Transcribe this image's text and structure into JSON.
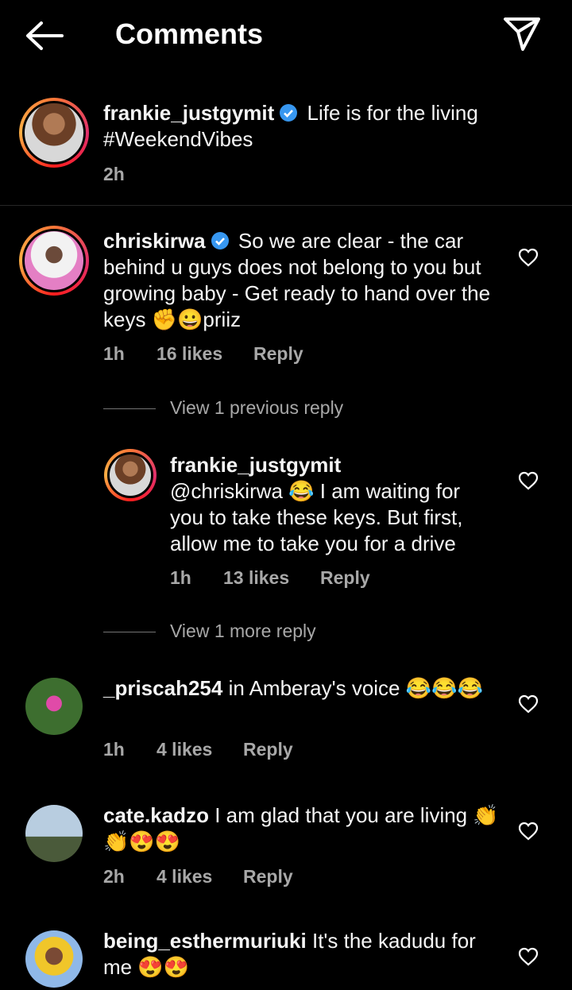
{
  "header": {
    "title": "Comments",
    "back_icon": "arrow-left-icon",
    "share_icon": "paper-plane-icon"
  },
  "caption": {
    "username": "frankie_justgymit",
    "text": "Life is for the living #WeekendVibes",
    "time": "2h",
    "verified": true
  },
  "comments": [
    {
      "username": "chriskirwa",
      "verified": true,
      "text": "So we are clear - the car behind u guys does not belong to you but growing  baby - Get ready to hand over the keys ✊😀priiz",
      "time": "1h",
      "likes": "16 likes",
      "reply": "Reply"
    },
    {
      "username": "frankie_justgymit",
      "text": "@chriskirwa 😂 I am waiting for you to take these keys. But first, allow me to take you for a drive",
      "time": "1h",
      "likes": "13 likes",
      "reply": "Reply"
    },
    {
      "username": "_priscah254",
      "text": "in Amberay's voice 😂😂😂",
      "time": "1h",
      "likes": "4 likes",
      "reply": "Reply"
    },
    {
      "username": "cate.kadzo",
      "text": "I am glad that you are living 👏👏😍😍",
      "time": "2h",
      "likes": "4 likes",
      "reply": "Reply"
    },
    {
      "username": "being_esthermuriuki",
      "text": "It's the kadudu for me 😍😍"
    }
  ],
  "view_previous": "View 1 previous reply",
  "view_more": "View 1 more reply",
  "colors": {
    "background": "#000000",
    "text": "#f5f5f5",
    "muted": "#a8a8a8",
    "verified": "#3797f0"
  }
}
